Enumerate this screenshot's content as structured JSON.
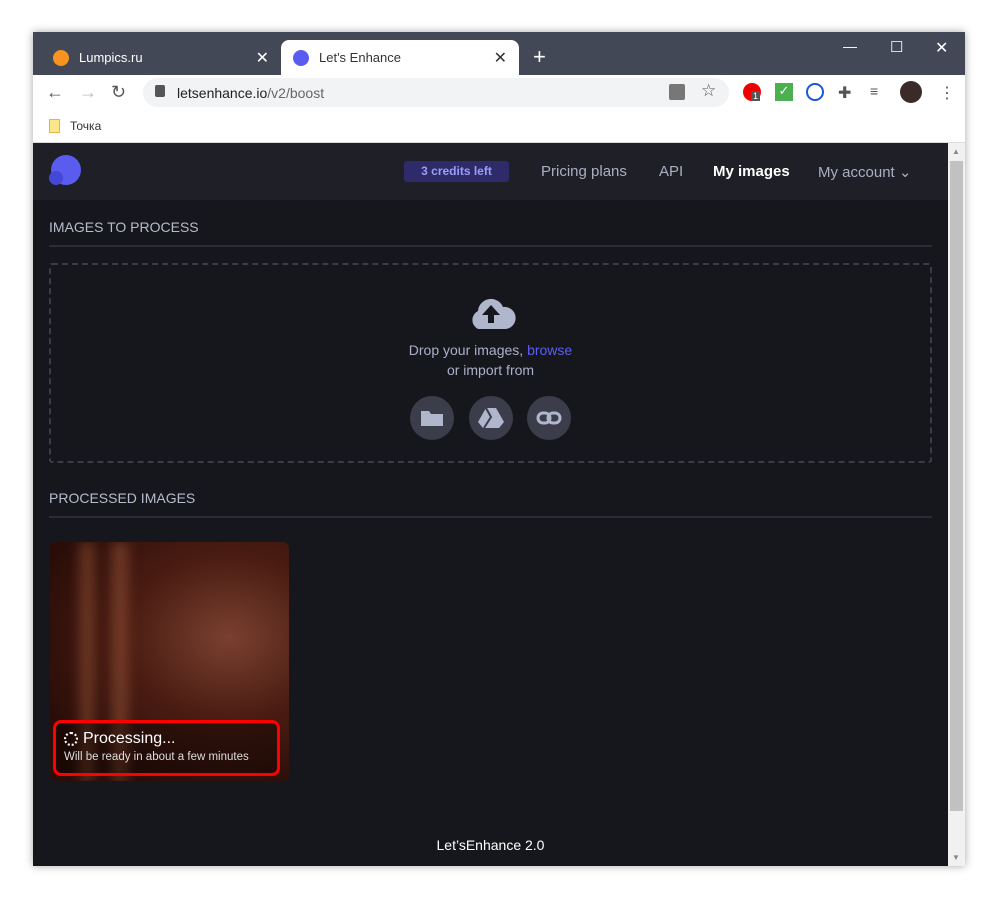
{
  "browser": {
    "tabs": [
      {
        "title": "Lumpics.ru",
        "active": false
      },
      {
        "title": "Let's Enhance",
        "active": true
      }
    ],
    "url_host": "letsenhance.io",
    "url_path": "/v2/boost",
    "bookmarks": [
      {
        "label": "Точка"
      }
    ],
    "extension_badge": "1"
  },
  "header": {
    "credits": "3 credits left",
    "nav": [
      "Pricing plans",
      "API",
      "My images",
      "My account"
    ]
  },
  "upload": {
    "section_title": "IMAGES TO PROCESS",
    "drop_text": "Drop your images, ",
    "browse": "browse",
    "import_text": "or import from"
  },
  "processed": {
    "section_title": "PROCESSED IMAGES",
    "items": [
      {
        "status": "Processing...",
        "detail": "Will be ready in about a few minutes"
      }
    ]
  },
  "footer": "Let’sEnhance 2.0",
  "colors": {
    "accent": "#5b5ef7",
    "background": "#16171c",
    "highlight": "#ff0000"
  }
}
